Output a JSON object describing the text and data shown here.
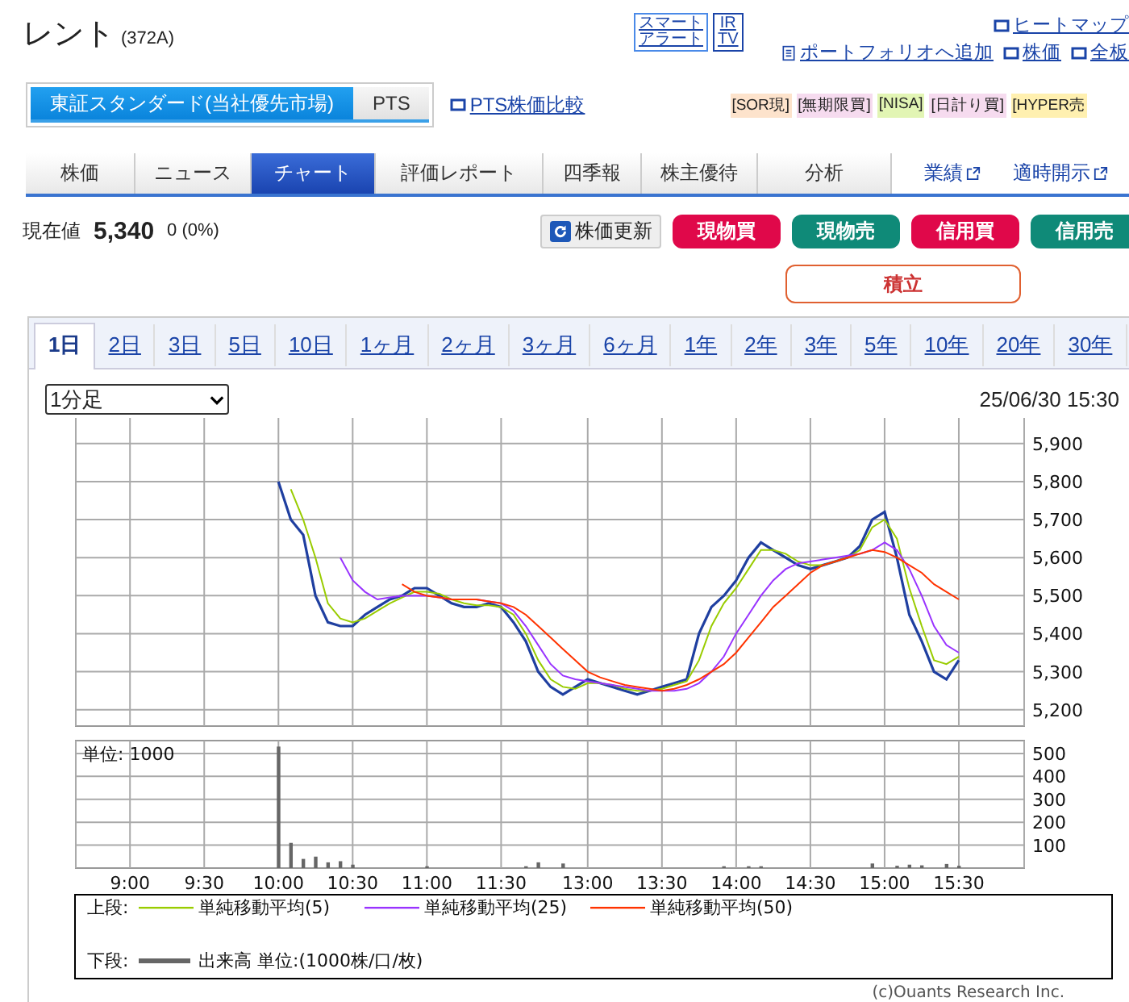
{
  "header": {
    "title": "レント",
    "code": "(372A)",
    "alert_box": [
      "スマート",
      "アラート"
    ],
    "irtv_box": [
      "IR",
      "TV"
    ],
    "links_row1": [
      {
        "label": "ヒートマップ",
        "kind": "window"
      }
    ],
    "links_row2": [
      {
        "label": "ポートフォリオへ追加",
        "kind": "doc"
      },
      {
        "label": "株価",
        "kind": "window"
      },
      {
        "label": "全板",
        "kind": "window"
      }
    ]
  },
  "market_tabs": [
    {
      "label": "東証スタンダード(当社優先市場)",
      "selected": true
    },
    {
      "label": "PTS",
      "selected": false
    }
  ],
  "pts_link": "PTS株価比較",
  "badges": [
    {
      "label": "[SOR現]",
      "color": "#fde3cc"
    },
    {
      "label": "[無期限買]",
      "color": "#f6dbef"
    },
    {
      "label": "[NISA]",
      "color": "#e2f5b4"
    },
    {
      "label": "[日計り買]",
      "color": "#f6dbef"
    },
    {
      "label": "[HYPER売",
      "color": "#fff0b0"
    }
  ],
  "nav_tabs": [
    {
      "label": "株価",
      "selected": false
    },
    {
      "label": "ニュース",
      "selected": false
    },
    {
      "label": "チャート",
      "selected": true
    },
    {
      "label": "評価レポート",
      "selected": false
    },
    {
      "label": "四季報",
      "selected": false
    },
    {
      "label": "株主優待",
      "selected": false
    },
    {
      "label": "分析",
      "selected": false
    }
  ],
  "nav_links": [
    "業績",
    "適時開示"
  ],
  "quote": {
    "label": "現在値",
    "price": "5,340",
    "change": "0 (0%)"
  },
  "actions": [
    {
      "label": "株価更新",
      "kind": "refresh"
    },
    {
      "label": "現物買",
      "kind": "buy"
    },
    {
      "label": "現物売",
      "kind": "sell"
    },
    {
      "label": "信用買",
      "kind": "buy"
    },
    {
      "label": "信用売",
      "kind": "sell"
    }
  ],
  "accumulate_button": "積立",
  "period_tabs": [
    {
      "label": "1日",
      "selected": true
    },
    {
      "label": "2日",
      "selected": false
    },
    {
      "label": "3日",
      "selected": false
    },
    {
      "label": "5日",
      "selected": false
    },
    {
      "label": "10日",
      "selected": false
    },
    {
      "label": "1ヶ月",
      "selected": false
    },
    {
      "label": "2ヶ月",
      "selected": false
    },
    {
      "label": "3ヶ月",
      "selected": false
    },
    {
      "label": "6ヶ月",
      "selected": false
    },
    {
      "label": "1年",
      "selected": false
    },
    {
      "label": "2年",
      "selected": false
    },
    {
      "label": "3年",
      "selected": false
    },
    {
      "label": "5年",
      "selected": false
    },
    {
      "label": "10年",
      "selected": false
    },
    {
      "label": "20年",
      "selected": false
    },
    {
      "label": "30年",
      "selected": false
    }
  ],
  "interval_select": "1分足",
  "timestamp": "25/06/30 15:30",
  "price_chart": {
    "legend_label": "上段:",
    "chart_data": {
      "type": "line",
      "grid": true,
      "categories": [
        null,
        null,
        null,
        null,
        null,
        null,
        null,
        null,
        null,
        null,
        null,
        null,
        null,
        null,
        null,
        null,
        null,
        null,
        null,
        null,
        null,
        null,
        null,
        null,
        null,
        null,
        null,
        null,
        null,
        null,
        null,
        null,
        null,
        null,
        null,
        null,
        null,
        null,
        null,
        null,
        null,
        null,
        null,
        null,
        null,
        null,
        null,
        null,
        null,
        null,
        null,
        null,
        null,
        null,
        null,
        null,
        null,
        null,
        null,
        null,
        null,
        null,
        null,
        null,
        null,
        null,
        null,
        null
      ],
      "series": [
        {
          "color": "#1f3fa0",
          "values": [
            null,
            null,
            null,
            null,
            null,
            null,
            null,
            null,
            null,
            null,
            null,
            null,
            5800,
            5700,
            5660,
            5500,
            5430,
            5420,
            5420,
            5450,
            5470,
            5490,
            5500,
            5520,
            5520,
            5500,
            5480,
            5470,
            5470,
            5480,
            5470,
            5430,
            5380,
            5300,
            5260,
            5240,
            5260,
            5280,
            5270,
            5260,
            5250,
            5240,
            5250,
            5260,
            5270,
            5280,
            5400,
            5470,
            5500,
            5540,
            5600,
            5640,
            5620,
            5600,
            5580,
            5570,
            5580,
            5590,
            5600,
            5630,
            5700,
            5720,
            5600,
            5450,
            5380,
            5300,
            5280,
            5330
          ]
        },
        {
          "name": "単純移動平均(5)",
          "color": "#99cc00",
          "values": [
            null,
            null,
            null,
            null,
            null,
            null,
            null,
            null,
            null,
            null,
            null,
            null,
            null,
            5780,
            5700,
            5600,
            5480,
            5440,
            5430,
            5440,
            5460,
            5480,
            5495,
            5510,
            5510,
            5505,
            5490,
            5480,
            5475,
            5475,
            5470,
            5450,
            5400,
            5330,
            5280,
            5260,
            5255,
            5270,
            5270,
            5265,
            5255,
            5250,
            5250,
            5255,
            5265,
            5275,
            5330,
            5420,
            5480,
            5520,
            5570,
            5620,
            5620,
            5610,
            5590,
            5580,
            5580,
            5590,
            5600,
            5620,
            5680,
            5700,
            5650,
            5520,
            5420,
            5330,
            5320,
            5340
          ]
        },
        {
          "name": "単純移動平均(25)",
          "color": "#9933ff",
          "values": [
            null,
            null,
            null,
            null,
            null,
            null,
            null,
            null,
            null,
            null,
            null,
            null,
            null,
            null,
            null,
            null,
            null,
            5600,
            5540,
            5510,
            5490,
            5495,
            5500,
            5500,
            5500,
            5495,
            5490,
            5490,
            5490,
            5485,
            5480,
            5460,
            5420,
            5370,
            5320,
            5290,
            5280,
            5275,
            5270,
            5265,
            5260,
            5255,
            5250,
            5250,
            5250,
            5255,
            5270,
            5300,
            5340,
            5400,
            5450,
            5500,
            5540,
            5570,
            5585,
            5590,
            5595,
            5600,
            5605,
            5610,
            5620,
            5640,
            5620,
            5570,
            5500,
            5420,
            5370,
            5350
          ]
        },
        {
          "name": "単純移動平均(50)",
          "color": "#ff3300",
          "values": [
            null,
            null,
            null,
            null,
            null,
            null,
            null,
            null,
            null,
            null,
            null,
            null,
            null,
            null,
            null,
            null,
            null,
            null,
            null,
            null,
            null,
            null,
            5530,
            5510,
            5500,
            5495,
            5490,
            5490,
            5490,
            5485,
            5480,
            5470,
            5450,
            5420,
            5390,
            5360,
            5330,
            5300,
            5285,
            5275,
            5265,
            5260,
            5255,
            5250,
            5255,
            5265,
            5280,
            5300,
            5320,
            5350,
            5390,
            5430,
            5470,
            5500,
            5530,
            5560,
            5580,
            5590,
            5600,
            5610,
            5620,
            5615,
            5600,
            5580,
            5560,
            5530,
            5510,
            5490
          ]
        }
      ],
      "ylim": [
        5157,
        5976
      ],
      "yticks": [
        {
          "value": 5200,
          "label": "5,200"
        },
        {
          "value": 5300,
          "label": "5,300"
        },
        {
          "value": 5400,
          "label": "5,400"
        },
        {
          "value": 5500,
          "label": "5,500"
        },
        {
          "value": 5600,
          "label": "5,600"
        },
        {
          "value": 5700,
          "label": "5,700"
        },
        {
          "value": 5800,
          "label": "5,800"
        },
        {
          "value": 5900,
          "label": "5,900"
        }
      ]
    }
  },
  "volume_chart": {
    "unit_label": "単位: 1000",
    "legend_label": "下段:",
    "chart_data": {
      "type": "bar",
      "grid": true,
      "categories": [
        "9:00",
        null,
        null,
        null,
        null,
        null,
        "9:30",
        null,
        null,
        null,
        null,
        null,
        "10:00",
        null,
        null,
        null,
        null,
        null,
        "10:30",
        null,
        null,
        null,
        null,
        null,
        "11:00",
        null,
        null,
        null,
        null,
        null,
        "11:30",
        null,
        null,
        null,
        null,
        null,
        null,
        "13:00",
        null,
        null,
        null,
        null,
        null,
        "13:30",
        null,
        null,
        null,
        null,
        null,
        "14:00",
        null,
        null,
        null,
        null,
        null,
        "14:30",
        null,
        null,
        null,
        null,
        null,
        "15:00",
        null,
        null,
        null,
        null,
        null,
        "15:30"
      ],
      "series": [
        {
          "name": "出来高 単位:(1000株/口/枚)",
          "color": "#666666",
          "values": [
            null,
            null,
            null,
            null,
            null,
            null,
            null,
            null,
            null,
            null,
            null,
            null,
            530,
            110,
            40,
            50,
            25,
            30,
            15,
            null,
            null,
            null,
            null,
            null,
            8,
            null,
            null,
            null,
            null,
            null,
            null,
            null,
            8,
            25,
            null,
            20,
            null,
            null,
            null,
            null,
            null,
            null,
            null,
            null,
            null,
            null,
            null,
            null,
            8,
            null,
            8,
            8,
            null,
            null,
            null,
            null,
            null,
            null,
            null,
            null,
            20,
            null,
            10,
            15,
            12,
            null,
            18,
            10
          ]
        }
      ],
      "ylim": [
        0,
        556
      ],
      "yticks": [
        100,
        200,
        300,
        400,
        500
      ]
    }
  },
  "credit": "(c)Ouants Research Inc."
}
